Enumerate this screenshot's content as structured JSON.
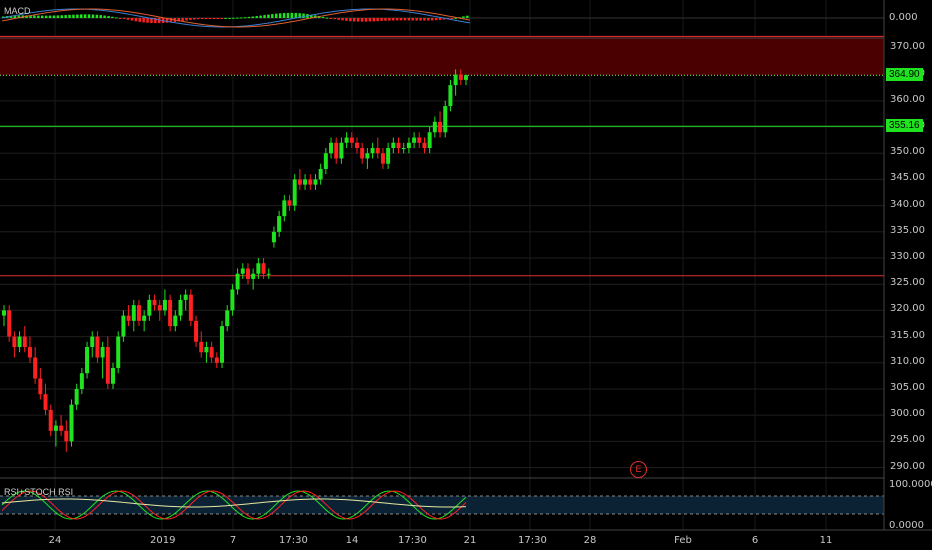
{
  "chart_data": {
    "type": "candlestick",
    "instrument_panes": {
      "macd": {
        "label": "MACD",
        "axis_value": "0.000"
      },
      "rsi": {
        "label": "RSI+STOCH RSI",
        "upper_value": "100.0000",
        "lower_value": "0.0000"
      }
    },
    "y_axis": {
      "ticks": [
        "370.00",
        "365.00",
        "360.00",
        "355.00",
        "350.00",
        "345.00",
        "340.00",
        "335.00",
        "330.00",
        "325.00",
        "320.00",
        "315.00",
        "310.00",
        "305.00",
        "300.00",
        "295.00",
        "290.00"
      ],
      "ylim": [
        288,
        372
      ]
    },
    "x_axis": {
      "ticks": [
        "24",
        "2019",
        "7",
        "17:30",
        "14",
        "17:30",
        "21",
        "17:30",
        "28",
        "Feb",
        "6",
        "11"
      ]
    },
    "price_tags": [
      {
        "value": "364.90",
        "color": "#1fe31f"
      },
      {
        "value": "355.16",
        "color": "#1fe31f"
      }
    ],
    "horizontal_lines": [
      {
        "value": 372.3,
        "color": "#e03030"
      },
      {
        "value": 364.9,
        "color": "#7cff4a",
        "dotted": true
      },
      {
        "value": 355.16,
        "color": "#1fe31f"
      },
      {
        "value": 326.6,
        "color": "#e03030"
      }
    ],
    "resistance_zone": {
      "from": 364.9,
      "to": 372.3,
      "color": "#4a0000"
    },
    "earnings_marker": {
      "label": "E"
    },
    "candles_approx": [
      [
        319,
        321,
        317,
        320
      ],
      [
        320,
        321,
        314,
        315
      ],
      [
        315,
        316,
        311,
        313
      ],
      [
        313,
        316,
        312,
        315
      ],
      [
        315,
        317,
        312,
        313
      ],
      [
        313,
        315,
        310,
        311
      ],
      [
        311,
        313,
        306,
        307
      ],
      [
        307,
        309,
        303,
        304
      ],
      [
        304,
        306,
        300,
        301
      ],
      [
        301,
        302,
        296,
        297
      ],
      [
        297,
        299,
        294,
        298
      ],
      [
        298,
        300,
        296,
        297
      ],
      [
        297,
        299,
        293,
        295
      ],
      [
        295,
        303,
        294,
        302
      ],
      [
        302,
        306,
        301,
        305
      ],
      [
        305,
        309,
        304,
        308
      ],
      [
        308,
        314,
        307,
        313
      ],
      [
        313,
        316,
        311,
        315
      ],
      [
        315,
        316,
        310,
        311
      ],
      [
        311,
        314,
        307,
        313
      ],
      [
        313,
        315,
        305,
        306
      ],
      [
        306,
        310,
        305,
        309
      ],
      [
        309,
        316,
        308,
        315
      ],
      [
        315,
        320,
        314,
        319
      ],
      [
        319,
        321,
        317,
        318
      ],
      [
        318,
        322,
        316,
        321
      ],
      [
        321,
        322,
        317,
        318
      ],
      [
        318,
        320,
        316,
        319
      ],
      [
        319,
        323,
        318,
        322
      ],
      [
        322,
        323,
        320,
        321
      ],
      [
        321,
        322,
        318,
        320
      ],
      [
        320,
        324,
        319,
        322
      ],
      [
        322,
        323,
        316,
        317
      ],
      [
        317,
        320,
        316,
        319
      ],
      [
        319,
        323,
        318,
        322
      ],
      [
        322,
        324,
        320,
        323
      ],
      [
        323,
        324,
        317,
        318
      ],
      [
        318,
        319,
        313,
        314
      ],
      [
        314,
        316,
        311,
        312
      ],
      [
        312,
        314,
        310,
        313
      ],
      [
        313,
        314,
        310,
        311
      ],
      [
        311,
        312,
        309,
        310
      ],
      [
        310,
        318,
        309,
        317
      ],
      [
        317,
        321,
        316,
        320
      ],
      [
        320,
        325,
        319,
        324
      ],
      [
        324,
        328,
        323,
        327
      ],
      [
        327,
        329,
        326,
        328
      ],
      [
        328,
        329,
        325,
        326
      ],
      [
        326,
        328,
        324,
        327
      ],
      [
        327,
        330,
        326,
        329
      ],
      [
        329,
        330,
        326,
        327
      ],
      [
        327,
        328,
        326,
        327
      ],
      [
        333,
        336,
        332,
        335
      ],
      [
        335,
        339,
        334,
        338
      ],
      [
        338,
        342,
        337,
        341
      ],
      [
        341,
        342,
        339,
        340
      ],
      [
        340,
        346,
        339,
        345
      ],
      [
        345,
        347,
        343,
        344
      ],
      [
        344,
        346,
        343,
        345
      ],
      [
        345,
        346,
        343,
        344
      ],
      [
        344,
        346,
        343,
        345
      ],
      [
        345,
        348,
        344,
        347
      ],
      [
        347,
        351,
        346,
        350
      ],
      [
        350,
        353,
        349,
        352
      ],
      [
        352,
        353,
        348,
        349
      ],
      [
        349,
        353,
        348,
        352
      ],
      [
        352,
        354,
        351,
        353
      ],
      [
        353,
        354,
        351,
        352
      ],
      [
        352,
        353,
        350,
        351
      ],
      [
        351,
        352,
        348,
        349
      ],
      [
        349,
        351,
        347,
        350
      ],
      [
        350,
        352,
        349,
        351
      ],
      [
        351,
        353,
        349,
        350
      ],
      [
        350,
        351,
        347,
        348
      ],
      [
        348,
        352,
        347,
        351
      ],
      [
        351,
        353,
        350,
        352
      ],
      [
        352,
        353,
        350,
        351
      ],
      [
        351,
        352,
        350,
        351
      ],
      [
        351,
        353,
        350,
        352
      ],
      [
        352,
        354,
        351,
        353
      ],
      [
        353,
        354,
        351,
        352
      ],
      [
        352,
        353,
        350,
        351
      ],
      [
        351,
        355,
        350,
        354
      ],
      [
        354,
        357,
        353,
        356
      ],
      [
        356,
        358,
        353,
        354
      ],
      [
        354,
        360,
        353,
        359
      ],
      [
        359,
        364,
        358,
        363
      ],
      [
        363,
        366,
        361,
        365
      ],
      [
        365,
        366,
        363,
        364
      ],
      [
        364,
        365,
        363,
        364.9
      ]
    ]
  }
}
